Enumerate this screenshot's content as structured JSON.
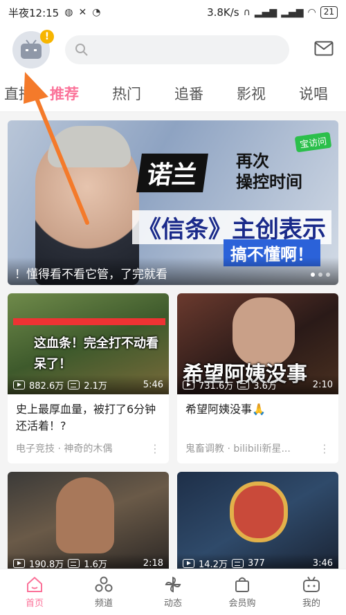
{
  "statusbar": {
    "time": "半夜12:15",
    "speed": "3.8K/s",
    "battery": "21"
  },
  "search": {
    "placeholder": ""
  },
  "tabs": [
    "直播",
    "推荐",
    "热门",
    "追番",
    "影视",
    "说唱"
  ],
  "banner": {
    "title_1": "诺兰",
    "title_2a": "再次",
    "title_2b": "操控时间",
    "title_3": "《信条》主创表示",
    "title_4": "搞不懂啊！",
    "tag": "宝访问",
    "caption": "！懂得看不看它管，了完就看"
  },
  "cards": [
    {
      "overlay": "这血条！完全打不动看呆了！",
      "views": "882.6万",
      "danmaku": "2.1万",
      "duration": "5:46",
      "title": "史上最厚血量，被打了6分钟还活着！?",
      "meta": "电子竞技 · 神奇的木偶"
    },
    {
      "overlay": "希望阿姨没事",
      "views": "731.6万",
      "danmaku": "3.6万",
      "duration": "2:10",
      "title": "希望阿姨没事🙏",
      "meta": "鬼畜调教 · bilibili新星..."
    },
    {
      "overlay": "",
      "views": "190.8万",
      "danmaku": "1.6万",
      "duration": "2:18",
      "title": "",
      "meta": ""
    },
    {
      "overlay": "",
      "views": "14.2万",
      "danmaku": "377",
      "duration": "3:46",
      "title": "",
      "meta": ""
    }
  ],
  "bottomnav": [
    "首页",
    "频道",
    "动态",
    "会员购",
    "我的"
  ],
  "colors": {
    "accent": "#fb7299",
    "badge": "#f7b500",
    "arrow": "#f47a2a"
  }
}
